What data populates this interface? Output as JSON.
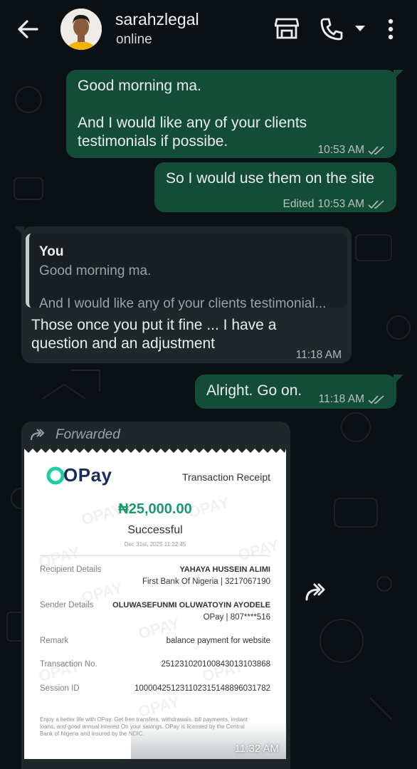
{
  "header": {
    "contact_name": "sarahzlegal",
    "status": "online",
    "icons": [
      "back-arrow-icon",
      "avatar",
      "shop-icon",
      "phone-icon",
      "chevron-down-icon",
      "more-vert-icon"
    ]
  },
  "colors": {
    "outgoing_bubble": "#144d37",
    "incoming_bubble": "#1f272a",
    "background": "#0b1014",
    "opay_green": "#1dcf9f",
    "amount_green": "#1a9a6c"
  },
  "messages": [
    {
      "id": "m1",
      "direction": "outgoing",
      "text": "Good morning ma.\n\nAnd I would like any of your clients testimonials if possibe.",
      "time": "10:53 AM",
      "ticks": "read"
    },
    {
      "id": "m2",
      "direction": "outgoing",
      "text": "So I would use them on the site",
      "edited_label": "Edited",
      "time": "10:53 AM",
      "ticks": "read"
    },
    {
      "id": "m3",
      "direction": "incoming",
      "quote_author": "You",
      "quote_line1": "Good morning ma.",
      "quote_line2": "And I would like any of your clients testimonial...",
      "text": "Those once you put it fine ... I have a\nquestion and an adjustment",
      "time": "11:18 AM"
    },
    {
      "id": "m4",
      "direction": "outgoing",
      "text": "Alright. Go on.",
      "time": "11:18 AM",
      "ticks": "read"
    },
    {
      "id": "m5",
      "direction": "incoming",
      "forwarded_label": "Forwarded",
      "time": "11:32 AM"
    }
  ],
  "receipt": {
    "brand": "OPay",
    "title": "Transaction Receipt",
    "amount": "₦25,000.00",
    "status": "Successful",
    "datetime": "Dec 31st, 2025 11:22:45",
    "recipient_label": "Recipient Details",
    "recipient_name": "YAHAYA HUSSEIN ALIMI",
    "recipient_bank": "First Bank Of Nigeria | 3217067190",
    "sender_label": "Sender Details",
    "sender_name": "OLUWASEFUNMI OLUWATOYIN AYODELE",
    "sender_bank": "OPay | 807****516",
    "remark_label": "Remark",
    "remark_value": "balance payment for website",
    "txn_label": "Transaction No.",
    "txn_value": "251231020100843013103868",
    "session_label": "Session ID",
    "session_value": "100004251231102315148896031782",
    "footer": "Enjoy a better life with OPay. Get free transfers, withdrawals, bill payments, instant loans, and good annual interest On your savings. OPay is licensed by the Central Bank of Nigeria and insured by the NDIC.",
    "watermark": "OPAY"
  }
}
